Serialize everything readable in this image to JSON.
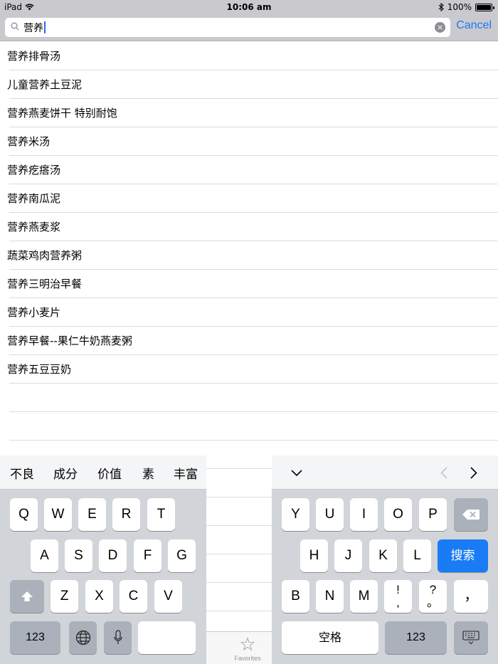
{
  "status": {
    "device": "iPad",
    "wifi_icon": "wifi-icon",
    "time": "10:06 am",
    "bluetooth_icon": "bluetooth-icon",
    "battery": "100%",
    "battery_level": 1.0
  },
  "search": {
    "query": "营养",
    "cancel_label": "Cancel",
    "clear_icon": "×"
  },
  "results": [
    "营养排骨汤",
    "儿童营养土豆泥",
    "营养燕麦饼干 特别耐饱",
    "营养米汤",
    "营养疙瘩汤",
    "营养南瓜泥",
    "营养燕麦浆",
    "蔬菜鸡肉营养粥",
    "营养三明治早餐",
    "营养小麦片",
    "营养早餐--果仁牛奶燕麦粥",
    "营养五豆豆奶"
  ],
  "tabbar": {
    "favorites_label": "Favorites",
    "favorites_icon": "star-icon"
  },
  "keyboard": {
    "candidates": [
      "不良",
      "成分",
      "价值",
      "素",
      "丰富"
    ],
    "collapse_icon": "chevron-down-icon",
    "prev_icon": "chevron-left-icon",
    "next_icon": "chevron-right-icon",
    "left_row1": [
      "Q",
      "W",
      "E",
      "R",
      "T"
    ],
    "left_row2": [
      "A",
      "S",
      "D",
      "F",
      "G"
    ],
    "left_row3": [
      "Z",
      "X",
      "C",
      "V"
    ],
    "right_row1": [
      "Y",
      "U",
      "I",
      "O",
      "P"
    ],
    "right_row2": [
      "H",
      "J",
      "K",
      "L"
    ],
    "right_row3": [
      "B",
      "N",
      "M"
    ],
    "punct1_top": "!",
    "punct1_bottom": ",",
    "punct2_top": "?",
    "punct2_bottom": "。",
    "punct3": "，",
    "search_key": "搜索",
    "space_key": "空格",
    "numbers_key": "123",
    "shift_icon": "shift-icon",
    "globe_icon": "globe-icon",
    "mic_icon": "mic-icon",
    "delete_icon": "delete-icon",
    "hide_keyboard_icon": "hide-keyboard-icon"
  }
}
